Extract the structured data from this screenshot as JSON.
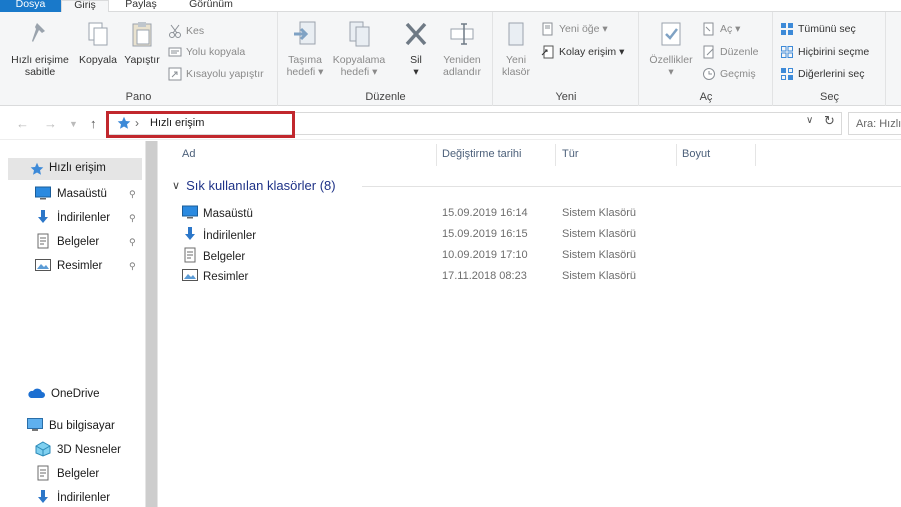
{
  "tabs": [
    {
      "label": "Dosya"
    },
    {
      "label": "Giriş"
    },
    {
      "label": "Paylaş"
    },
    {
      "label": "Görünüm"
    }
  ],
  "ribbon": {
    "pano": {
      "label": "Pano",
      "pin_label_1": "Hızlı erişime",
      "pin_label_2": "sabitle",
      "copy_label": "Kopyala",
      "paste_label": "Yapıştır",
      "cut_label": "Kes",
      "copy_path_label": "Yolu kopyala",
      "paste_shortcut_label": "Kısayolu yapıştır"
    },
    "duzenle": {
      "label": "Düzenle",
      "move_label_1": "Taşıma",
      "move_label_2": "hedefi ▾",
      "copyto_label_1": "Kopyalama",
      "copyto_label_2": "hedefi ▾",
      "delete_label_1": "Sil",
      "delete_label_2": "▾",
      "rename_label_1": "Yeniden",
      "rename_label_2": "adlandır"
    },
    "yeni": {
      "label": "Yeni",
      "new_folder_label_1": "Yeni",
      "new_folder_label_2": "klasör",
      "new_item_label": "Yeni öğe ▾",
      "easy_access_label": "Kolay erişim ▾"
    },
    "ac": {
      "label": "Aç",
      "properties_label_1": "Özellikler",
      "properties_label_2": "▾",
      "open_label": "Aç ▾",
      "edit_label": "Düzenle",
      "history_label": "Geçmiş"
    },
    "sec": {
      "label": "Seç",
      "select_all_label": "Tümünü seç",
      "select_none_label": "Hiçbirini seçme",
      "invert_label": "Diğerlerini seç"
    }
  },
  "address": {
    "crumb": "Hızlı erişim",
    "search_placeholder": "Ara: Hızlı erişim"
  },
  "nav": {
    "quick_access": "Hızlı erişim",
    "pinned": [
      {
        "label": "Masaüstü"
      },
      {
        "label": "İndirilenler"
      },
      {
        "label": "Belgeler"
      },
      {
        "label": "Resimler"
      }
    ],
    "onedrive": "OneDrive",
    "this_pc": "Bu bilgisayar",
    "pc_items": [
      {
        "label": "3D Nesneler"
      },
      {
        "label": "Belgeler"
      },
      {
        "label": "İndirilenler"
      }
    ]
  },
  "columns": {
    "name": "Ad",
    "date": "Değiştirme tarihi",
    "type": "Tür",
    "size": "Boyut"
  },
  "group_header": "Sık kullanılan klasörler (8)",
  "files": [
    {
      "name": "Masaüstü",
      "date": "15.09.2019 16:14",
      "type": "Sistem Klasörü",
      "icon": "desktop-icon"
    },
    {
      "name": "İndirilenler",
      "date": "15.09.2019 16:15",
      "type": "Sistem Klasörü",
      "icon": "download-icon"
    },
    {
      "name": "Belgeler",
      "date": "10.09.2019 17:10",
      "type": "Sistem Klasörü",
      "icon": "documents-icon"
    },
    {
      "name": "Resimler",
      "date": "17.11.2018 08:23",
      "type": "Sistem Klasörü",
      "icon": "pictures-icon"
    }
  ],
  "colors": {
    "file_tab": "#1979ca",
    "highlight_box": "#c1272d",
    "group_header": "#1e3287"
  }
}
